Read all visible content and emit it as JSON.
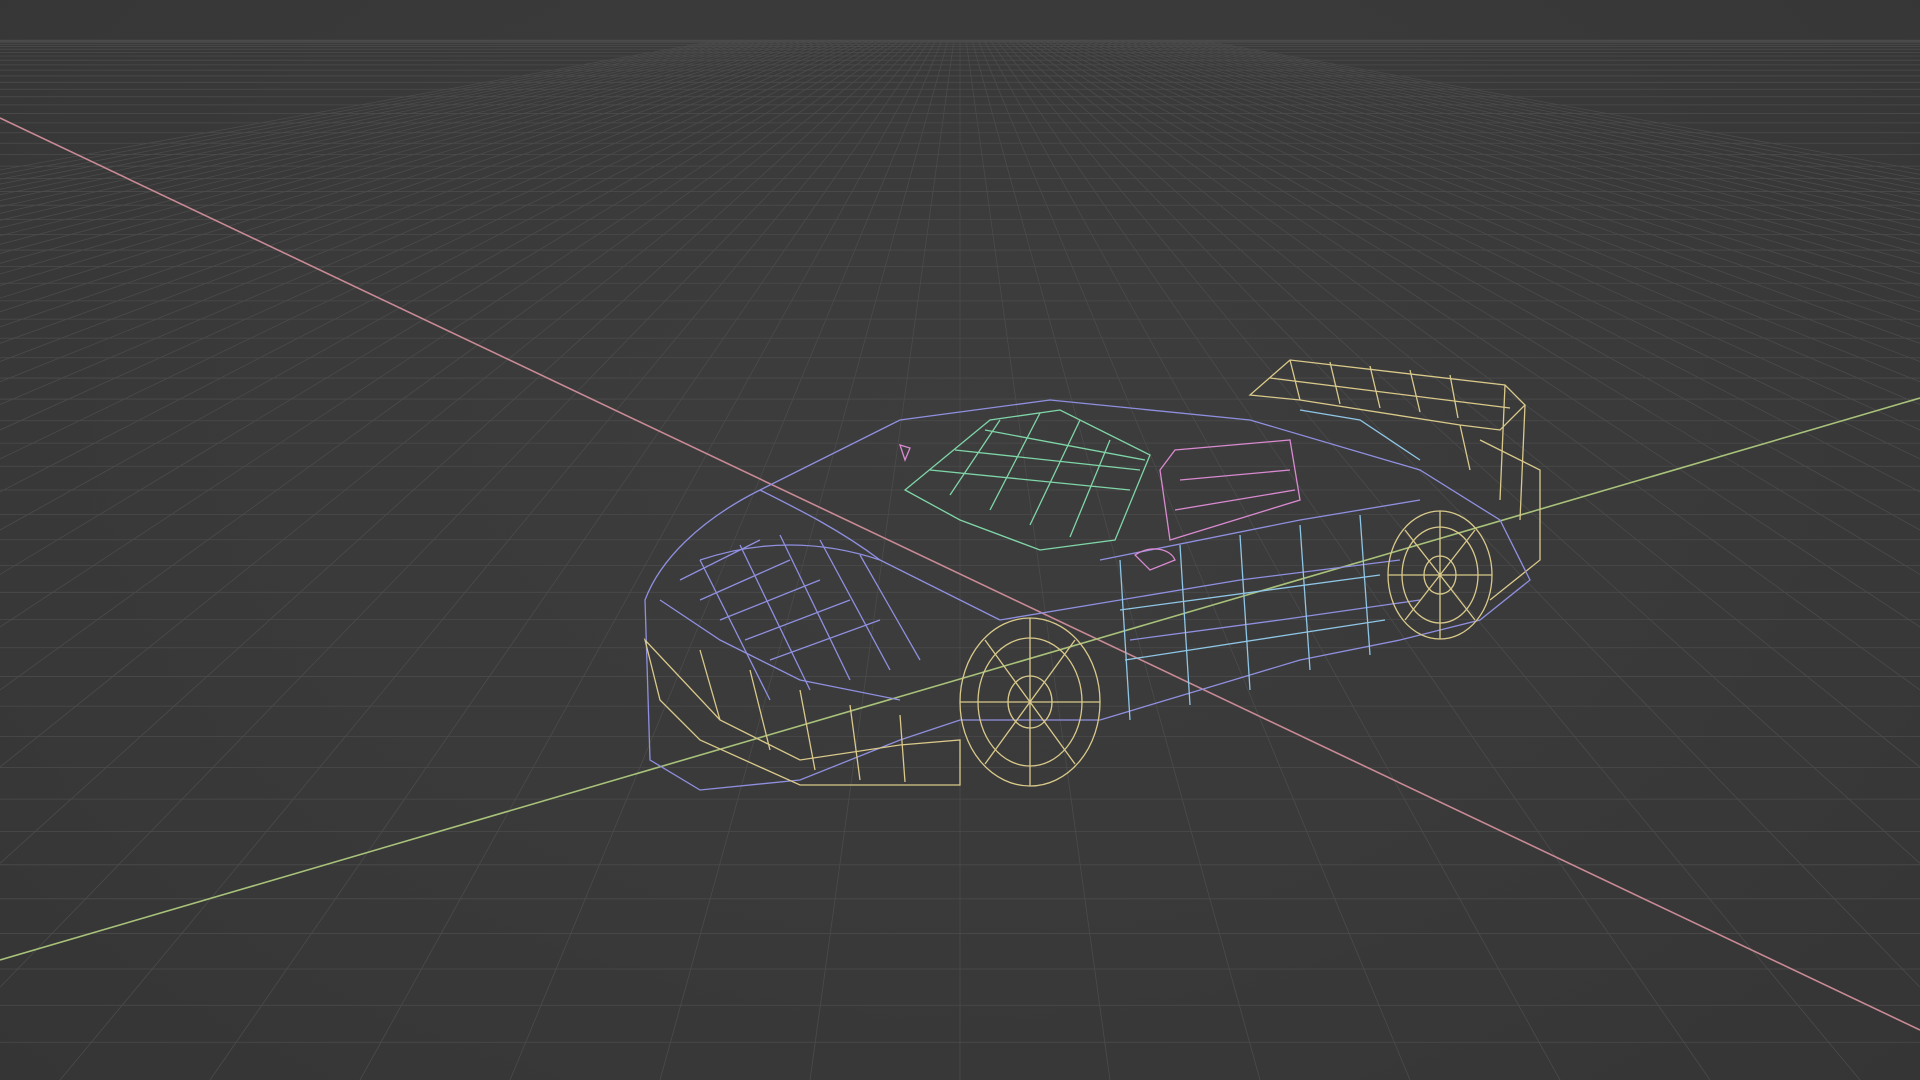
{
  "viewport": {
    "background_color": "#3a3a3a",
    "grid_color": "#4b4b4b",
    "axis_x_color": "#c98a96",
    "axis_y_color": "#a9c27a"
  },
  "model": {
    "display_mode": "wireframe",
    "subject": "sports car",
    "palette": {
      "body": "#8f8fe0",
      "glass": "#7fd6a8",
      "side": "#8fc6e6",
      "wheels": "#d9c98a",
      "spoiler": "#d9c98a",
      "accent": "#d98ad0"
    }
  }
}
